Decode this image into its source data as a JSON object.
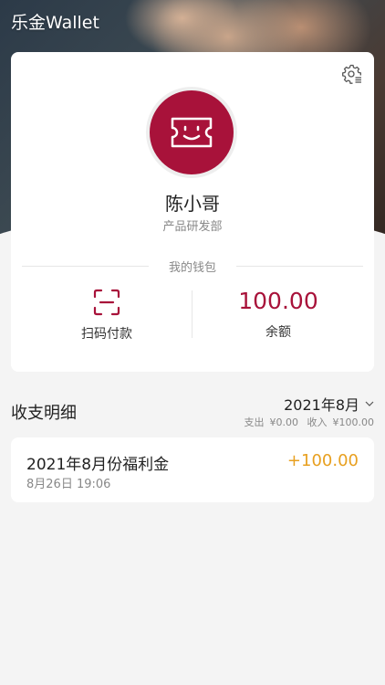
{
  "header": {
    "app_title": "乐金Wallet"
  },
  "profile": {
    "name": "陈小哥",
    "department": "产品研发部",
    "avatar_icon": "ticket-smile-icon",
    "accent_color": "#a8123a"
  },
  "wallet": {
    "section_label": "我的钱包",
    "scan_label": "扫码付款",
    "scan_icon": "scan-icon",
    "balance_value": "100.00",
    "balance_label": "余额"
  },
  "records": {
    "title": "收支明细",
    "month": "2021年8月",
    "expense_label": "支出",
    "expense_value": "¥0.00",
    "income_label": "收入",
    "income_value": "¥100.00",
    "items": [
      {
        "title": "2021年8月份福利金",
        "time": "8月26日 19:06",
        "amount": "+100.00",
        "amount_color": "#e8a020"
      }
    ]
  }
}
